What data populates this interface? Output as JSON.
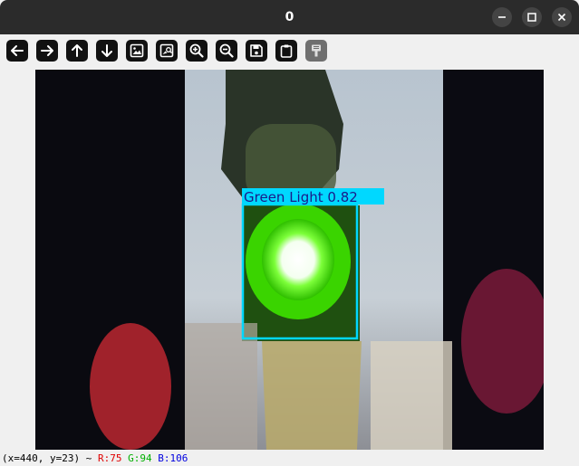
{
  "window": {
    "title": "0"
  },
  "toolbar": {
    "icons": [
      "arrow-left-icon",
      "arrow-right-icon",
      "arrow-up-icon",
      "arrow-down-icon",
      "image-icon",
      "image-magnify-icon",
      "zoom-in-icon",
      "zoom-out-icon",
      "save-icon",
      "clipboard-icon",
      "properties-icon"
    ]
  },
  "detection": {
    "label": "Green Light 0.82",
    "box_color": "#00d8ff"
  },
  "status": {
    "coords": "(x=440, y=23) ~",
    "r": "R:75",
    "g": "G:94",
    "b": "B:106"
  },
  "colors": {
    "r": "#e00000",
    "g": "#00b000",
    "b": "#0000e0"
  }
}
